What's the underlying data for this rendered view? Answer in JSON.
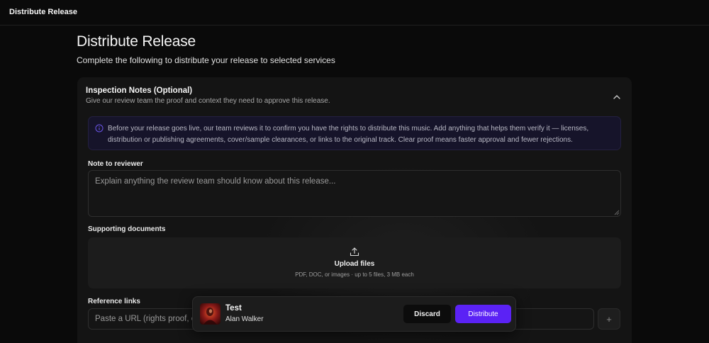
{
  "topbar": {
    "title": "Distribute Release"
  },
  "page": {
    "title": "Distribute Release",
    "subtitle": "Complete the following to distribute your release to selected services"
  },
  "inspection": {
    "title": "Inspection Notes (Optional)",
    "subtitle": "Give our review team the proof and context they need to approve this release.",
    "info": "Before your release goes live, our team reviews it to confirm you have the rights to distribute this music. Add anything that helps them verify it — licenses, distribution or publishing agreements, cover/sample clearances, or links to the original track. Clear proof means faster approval and fewer rejections.",
    "collapse_icon": "chevron-up-icon"
  },
  "note": {
    "label": "Note to reviewer",
    "placeholder": "Explain anything the review team should know about this release...",
    "value": ""
  },
  "documents": {
    "label": "Supporting documents",
    "upload_title": "Upload files",
    "upload_hint": "PDF, DOC, or images · up to 5 files, 3 MB each",
    "icon": "upload-icon"
  },
  "links": {
    "label": "Reference links",
    "placeholder": "Paste a URL (rights proof, original track, etc.)",
    "add_label": "+"
  },
  "player": {
    "title": "Test",
    "artist": "Alan Walker",
    "discard_label": "Discard",
    "distribute_label": "Distribute"
  },
  "colors": {
    "accent": "#5b22f5",
    "background": "#0a0a0a",
    "card": "#141414",
    "info_bg": "#16142a"
  }
}
